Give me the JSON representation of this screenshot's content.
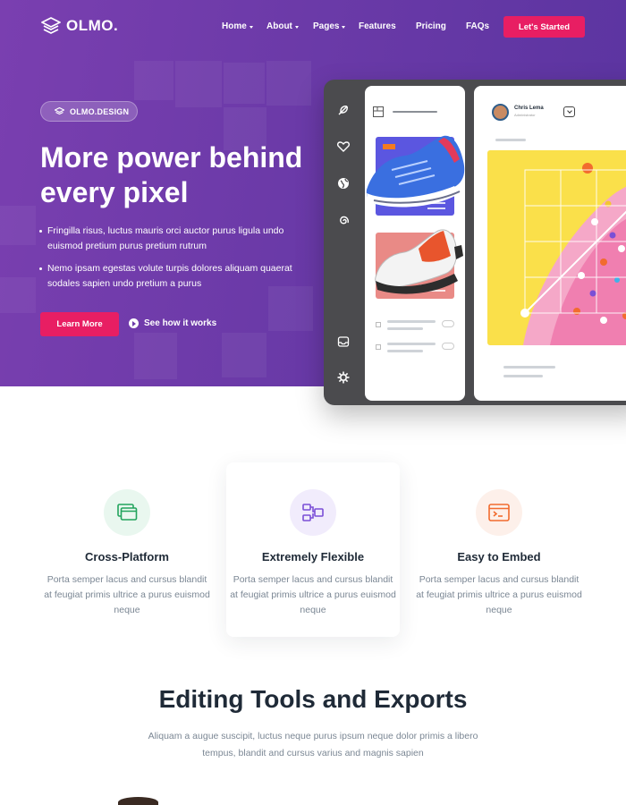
{
  "brand": {
    "name": "OLMO."
  },
  "nav": {
    "items": [
      {
        "label": "Home",
        "dropdown": true
      },
      {
        "label": "About",
        "dropdown": true
      },
      {
        "label": "Pages",
        "dropdown": true
      },
      {
        "label": "Features",
        "dropdown": false
      },
      {
        "label": "Pricing",
        "dropdown": false
      },
      {
        "label": "FAQs",
        "dropdown": false
      }
    ],
    "cta": "Let's Started"
  },
  "hero": {
    "badge": "OLMO.DESIGN",
    "headline": "More power behind every pixel",
    "bullets": [
      "Fringilla risus, luctus mauris orci auctor purus ligula undo euismod pretium purus pretium rutrum",
      "Nemo ipsam egestas volute turpis dolores aliquam quaerat sodales sapien undo pretium a purus"
    ],
    "primary_button": "Learn More",
    "secondary_link": "See how it works"
  },
  "mockup": {
    "user_name": "Chris Lema",
    "user_role": "Administrator"
  },
  "features": [
    {
      "title": "Cross-Platform",
      "description": "Porta semper lacus and cursus blandit at feugiat primis ultrice a purus euismod neque",
      "icon": "windows-stack-icon",
      "color": "#22a45d",
      "bg": "#e9f7ef"
    },
    {
      "title": "Extremely Flexible",
      "description": "Porta semper lacus and cursus blandit at feugiat primis ultrice a purus euismod neque",
      "icon": "flow-arrows-icon",
      "color": "#7b4fd6",
      "bg": "#f1ecfc"
    },
    {
      "title": "Easy to Embed",
      "description": "Porta semper lacus and cursus blandit at feugiat primis ultrice a purus euismod neque",
      "icon": "terminal-icon",
      "color": "#f26b2e",
      "bg": "#fdf0ea"
    }
  ],
  "section": {
    "title": "Editing Tools and Exports",
    "description": "Aliquam a augue suscipit, luctus neque purus ipsum neque dolor primis a libero tempus, blandit and cursus varius and magnis sapien"
  },
  "colors": {
    "accent": "#e81e63",
    "hero_bg": "#6b3aa8",
    "text_dark": "#1f2a37",
    "text_muted": "#7b8794"
  }
}
